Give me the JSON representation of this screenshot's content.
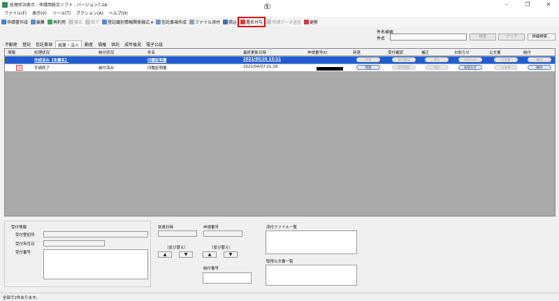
{
  "window": {
    "title": "処理状況表示 - 申請用総合ソフト - バージョン7.2A",
    "controls": [
      "–",
      "❐",
      "✕"
    ]
  },
  "annotation": {
    "marker": "①"
  },
  "menu": [
    "ファイル(F)",
    "表示(V)",
    "ツール(T)",
    "アクション(A)",
    "ヘルプ(H)"
  ],
  "toolbar": {
    "create": "申請書作成",
    "edit": "編集",
    "reuse": "再利用",
    "correct": "補正",
    "withdraw": "取下",
    "register_info": "登記識別情報関係様式 ▾",
    "trust": "信託事項作成",
    "attach": "ファイル添付",
    "check": "照込",
    "sign": "署名付与",
    "send": "申請データ送信",
    "refresh": "更新"
  },
  "search": {
    "title": "件名検索",
    "label": "件名",
    "value": "",
    "search_btn": "検索",
    "clear_btn": "クリア",
    "detail_btn": "詳細検索..."
  },
  "tabs": [
    "不動産",
    "登記",
    "信託事項",
    "商業・法人",
    "動産",
    "債権",
    "供託",
    "成年後見",
    "電子公証"
  ],
  "active_tab": 3,
  "grid": {
    "headers": [
      "情報",
      "処理状況",
      "納付状況",
      "件名",
      "最終更新日時",
      "申請番号ID",
      "到達",
      "受付確認",
      "補正",
      "お知らせ",
      "公文書",
      "納付"
    ],
    "rows": [
      {
        "status": "作成済み【未署名】",
        "payment": "",
        "subject": "印鑑証明書",
        "updated": "2021/04/20 15:11",
        "arrival": "到達",
        "receipt": "受付確認",
        "correction": "補正",
        "notice": "お知らせ",
        "official": "公文書",
        "pay": "納付"
      },
      {
        "status": "手続終了",
        "payment": "納付済み",
        "subject": "印鑑証明書",
        "updated": "2021/04/07 21:18",
        "arrival": "到達",
        "receipt": "受付確認",
        "correction": "補正",
        "notice": "お知らせ",
        "official": "公文書",
        "pay": "納付"
      }
    ]
  },
  "details": {
    "receipt_info": "受付情報",
    "receipt_office": "受付登記所",
    "receipt_date": "受付年月日",
    "receipt_number": "受付番号",
    "arrival_datetime": "到達日時",
    "sort_label_1": "（並び替え）",
    "application_number": "申請番号",
    "sort_label_2": "（並び替え）",
    "payment_number": "納付番号",
    "attached_files": "添付ファイル一覧",
    "acquired_docs": "取得公文書一覧",
    "up": "▲",
    "down": "▼"
  },
  "status": {
    "text": "全部で2件あります。"
  },
  "colors": {
    "selection": "#1f5ed6",
    "highlight_border": "#e00000"
  }
}
